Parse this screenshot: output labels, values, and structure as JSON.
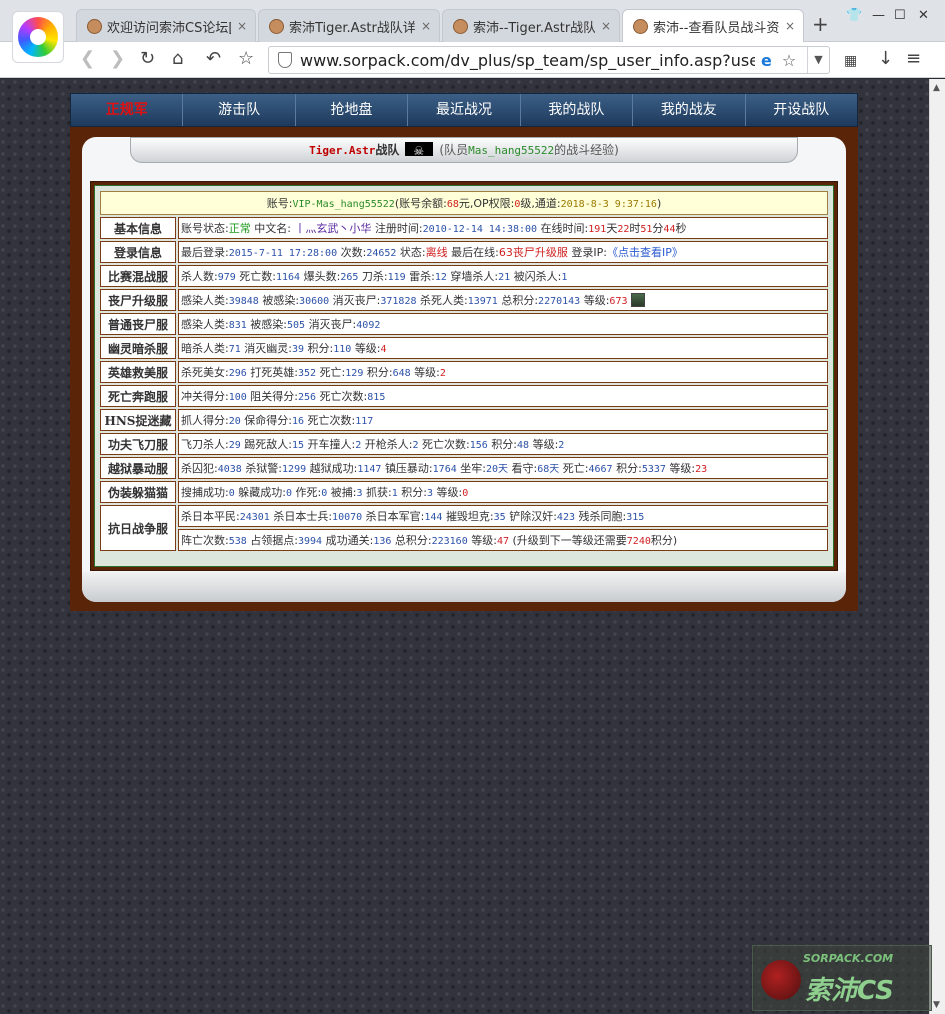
{
  "browser": {
    "tabs": [
      {
        "title": "欢迎访问索沛CS论坛[索"
      },
      {
        "title": "索沛Tiger.Astr战队详细"
      },
      {
        "title": "索沛--Tiger.Astr战队"
      },
      {
        "title": "索沛--查看队员战斗资料"
      }
    ],
    "close_glyph": "×",
    "new_tab": "+",
    "url": "www.sorpack.com/dv_plus/sp_team/sp_user_info.asp?user_nam"
  },
  "nav": {
    "items": [
      "正规军",
      "游击队",
      "抢地盘",
      "最近战况",
      "我的战队",
      "我的战友",
      "开设战队"
    ]
  },
  "panel": {
    "team_name": "Tiger.Astr",
    "team_word": "战队",
    "member_prefix": "(队员",
    "member_name": "Mas_hang55522",
    "member_suffix": "的战斗经验)"
  },
  "account": {
    "label_account": "账号:",
    "account_name": "VIP-Mas_hang55522",
    "balance_prefix": "(账号余额:",
    "balance": "68",
    "balance_suffix": "元,OP权限:",
    "op_level": "0",
    "op_suffix": "级,通道:",
    "timestamp": "2018-8-3 9:37:16",
    "close_paren": ")"
  },
  "rows": {
    "basic": {
      "label": "基本信息",
      "status_label": "账号状态:",
      "status": "正常",
      "cn_label": "中文名:",
      "cn_name": "丨灬玄武丶小华",
      "reg_label": "注册时间:",
      "reg_time": "2010-12-14 14:38:00",
      "online_label": "在线时间:",
      "days": "191",
      "days_unit": "天",
      "hours": "22",
      "hours_unit": "时",
      "mins": "51",
      "mins_unit": "分",
      "secs": "44",
      "secs_unit": "秒"
    },
    "login": {
      "label": "登录信息",
      "last_label": "最后登录:",
      "last_time": "2015-7-11 17:28:00",
      "count_label": "次数:",
      "count": "24652",
      "state_label": "状态:",
      "state": "离线",
      "last_online_label": "最后在线:",
      "last_online": "63丧尸升级服",
      "ip_label": "登录IP:",
      "ip_link": "《点击查看IP》"
    },
    "mix": {
      "label": "比赛混战服",
      "kills_label": "杀人数:",
      "kills": "979",
      "deaths_label": "死亡数:",
      "deaths": "1164",
      "hs_label": "爆头数:",
      "hs": "265",
      "knife_label": "刀杀:",
      "knife": "119",
      "mine_label": "雷杀:",
      "mine": "12",
      "wall_label": "穿墙杀人:",
      "wall": "21",
      "flash_label": "被闪杀人:",
      "flash": "1"
    },
    "zombie_up": {
      "label": "丧尸升级服",
      "infect_label": "感染人类:",
      "infect": "39848",
      "infected_label": "被感染:",
      "infected": "30600",
      "kill_z_label": "消灭丧尸:",
      "kill_z": "371828",
      "kill_h_label": "杀死人类:",
      "kill_h": "13971",
      "total_label": "总积分:",
      "total": "2270143",
      "level_label": "等级:",
      "level": "673"
    },
    "zombie_norm": {
      "label": "普通丧尸服",
      "infect_label": "感染人类:",
      "infect": "831",
      "infected_label": "被感染:",
      "infected": "505",
      "kill_z_label": "消灭丧尸:",
      "kill_z": "4092"
    },
    "ghost": {
      "label": "幽灵暗杀服",
      "kill_label": "暗杀人类:",
      "kill": "71",
      "ghost_label": "消灭幽灵:",
      "ghost": "39",
      "score_label": "积分:",
      "score": "110",
      "level_label": "等级:",
      "level": "4"
    },
    "hero": {
      "label": "英雄救美服",
      "a_label": "杀死美女:",
      "a": "296",
      "b_label": "打死英雄:",
      "b": "352",
      "c_label": "死亡:",
      "c": "129",
      "d_label": "积分:",
      "d": "648",
      "e_label": "等级:",
      "e": "2"
    },
    "death_run": {
      "label": "死亡奔跑服",
      "a_label": "冲关得分:",
      "a": "100",
      "b_label": "阻关得分:",
      "b": "256",
      "c_label": "死亡次数:",
      "c": "815"
    },
    "hns": {
      "label": "HNS捉迷藏",
      "a_label": "抓人得分:",
      "a": "20",
      "b_label": "保命得分:",
      "b": "16",
      "c_label": "死亡次数:",
      "c": "117"
    },
    "kungfu": {
      "label": "功夫飞刀服",
      "a_label": "飞刀杀人:",
      "a": "29",
      "b_label": "踢死敌人:",
      "b": "15",
      "c_label": "开车撞人:",
      "c": "2",
      "d_label": "开枪杀人:",
      "d": "2",
      "e_label": "死亡次数:",
      "e": "156",
      "f_label": "积分:",
      "f": "48",
      "g_label": "等级:",
      "g": "2"
    },
    "jail": {
      "label": "越狱暴动服",
      "a_label": "杀囚犯:",
      "a": "4038",
      "b_label": "杀狱警:",
      "b": "1299",
      "c_label": "越狱成功:",
      "c": "1147",
      "d_label": "镇压暴动:",
      "d": "1764",
      "e_label": "坐牢:",
      "e": "20天",
      "f_label": "看守:",
      "f": "68天",
      "g_label": "死亡:",
      "g": "4667",
      "h_label": "积分:",
      "h": "5337",
      "i_label": "等级:",
      "i": "23"
    },
    "disguise": {
      "label": "伪装躲猫猫",
      "a_label": "搜捕成功:",
      "a": "0",
      "b_label": "躲藏成功:",
      "b": "0",
      "c_label": "作死:",
      "c": "0",
      "d_label": "被捕:",
      "d": "3",
      "e_label": "抓获:",
      "e": "1",
      "f_label": "积分:",
      "f": "3",
      "g_label": "等级:",
      "g": "0"
    },
    "war": {
      "label": "抗日战争服",
      "a_label": "杀日本平民:",
      "a": "24301",
      "b_label": "杀日本士兵:",
      "b": "10070",
      "c_label": "杀日本军官:",
      "c": "144",
      "d_label": "摧毁坦克:",
      "d": "35",
      "e_label": "铲除汉奸:",
      "e": "423",
      "f_label": "残杀同胞:",
      "f": "315",
      "g_label": "阵亡次数:",
      "g": "538",
      "h_label": "占领据点:",
      "h": "3994",
      "i_label": "成功通关:",
      "i": "136",
      "j_label": "总积分:",
      "j": "223160",
      "k_label": "等级:",
      "k": "47",
      "l_prefix": "(升级到下一等级还需要",
      "l": "7240",
      "l_suffix": "积分)"
    }
  },
  "watermark": {
    "top": "SORPACK.COM",
    "main": "索沛CS"
  },
  "colors": {
    "nav_bg": "#2b4a70",
    "frame_brown": "#5a2408",
    "label_purple": "#800060",
    "value_blue": "#2c52a8",
    "value_red": "#d02020"
  }
}
